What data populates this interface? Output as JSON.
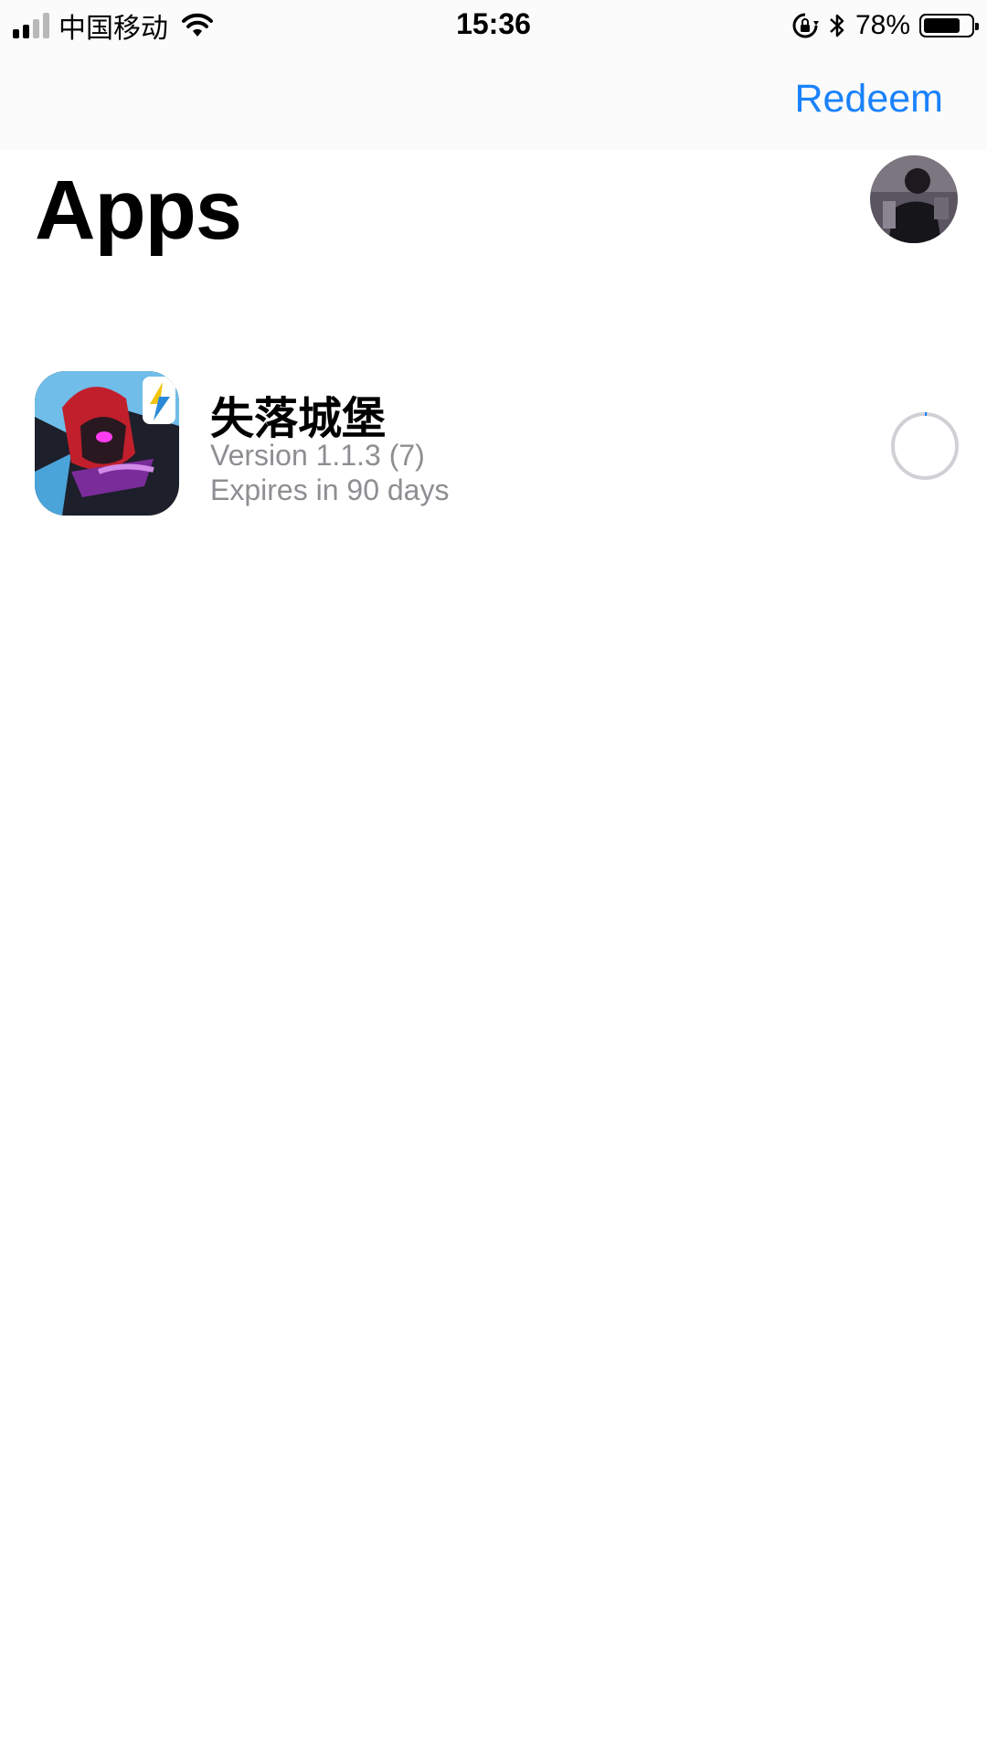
{
  "status_bar": {
    "carrier": "中国移动",
    "time": "15:36",
    "battery_percent": "78%",
    "battery_level": 0.78,
    "signal_bars_filled": 2,
    "signal_bars_total": 4,
    "icons": [
      "signal-icon",
      "wifi-icon",
      "orientation-lock-icon",
      "bluetooth-icon",
      "battery-icon"
    ]
  },
  "nav": {
    "redeem_label": "Redeem"
  },
  "page": {
    "title": "Apps"
  },
  "apps": [
    {
      "name": "失落城堡",
      "version": "Version 1.1.3 (7)",
      "expiry": "Expires in 90 days",
      "icon": "app-game-icon",
      "install_progress": 0.01
    }
  ],
  "colors": {
    "accent": "#1a82fb",
    "secondary_text": "#8e8e93",
    "bar_background": "#fbfbfb",
    "spinner_track": "#d0d0d5"
  }
}
